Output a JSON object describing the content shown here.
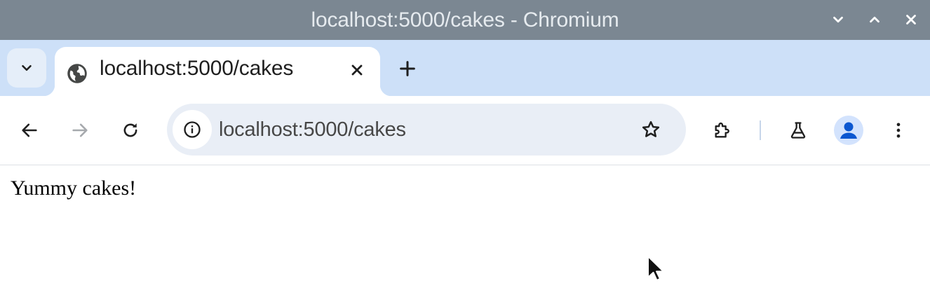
{
  "window": {
    "title": "localhost:5000/cakes - Chromium"
  },
  "tabs": [
    {
      "title": "localhost:5000/cakes",
      "favicon": "globe-icon",
      "active": true
    }
  ],
  "toolbar": {
    "url": "localhost:5000/cakes",
    "site_info_icon": "info-icon",
    "bookmark_icon": "star-icon",
    "extensions_icon": "puzzle-icon",
    "labs_icon": "flask-icon",
    "profile_icon": "person-icon",
    "menu_icon": "more-vert-icon"
  },
  "page": {
    "text": "Yummy cakes!"
  },
  "colors": {
    "titlebar": "#7b8792",
    "tabstrip": "#cde0f8",
    "omnibox": "#e9eef6",
    "accent": "#0b57d0"
  }
}
